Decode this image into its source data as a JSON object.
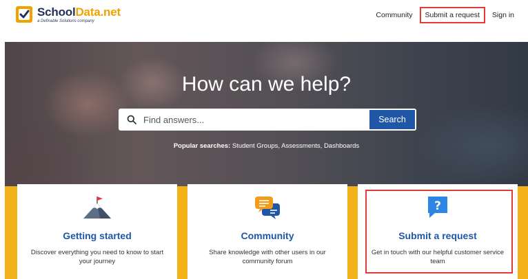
{
  "brand": {
    "name_part1": "School",
    "name_part2": "Data.net",
    "tagline": "a Definable Solutions company"
  },
  "nav": {
    "community": "Community",
    "submit_request": "Submit a request",
    "sign_in": "Sign in"
  },
  "hero": {
    "title": "How can we help?",
    "search_placeholder": "Find answers...",
    "search_button": "Search",
    "popular_label": "Popular searches:",
    "popular_items": [
      "Student Groups,",
      "Assessments,",
      "Dashboards"
    ]
  },
  "cards": [
    {
      "title": "Getting started",
      "description": "Discover everything you need to know to start your journey"
    },
    {
      "title": "Community",
      "description": "Share knowledge with other users in our community forum"
    },
    {
      "title": "Submit a request",
      "description": "Get in touch with our helpful customer service team"
    }
  ],
  "colors": {
    "brand_navy": "#22305a",
    "brand_orange": "#f0a300",
    "accent_blue": "#1f56a5",
    "band_yellow": "#f3b21a",
    "highlight_red": "#e53935"
  },
  "icons": [
    "logo-mark",
    "search-icon",
    "mountain-flag-icon",
    "chat-bubbles-icon",
    "question-bubble-icon"
  ]
}
